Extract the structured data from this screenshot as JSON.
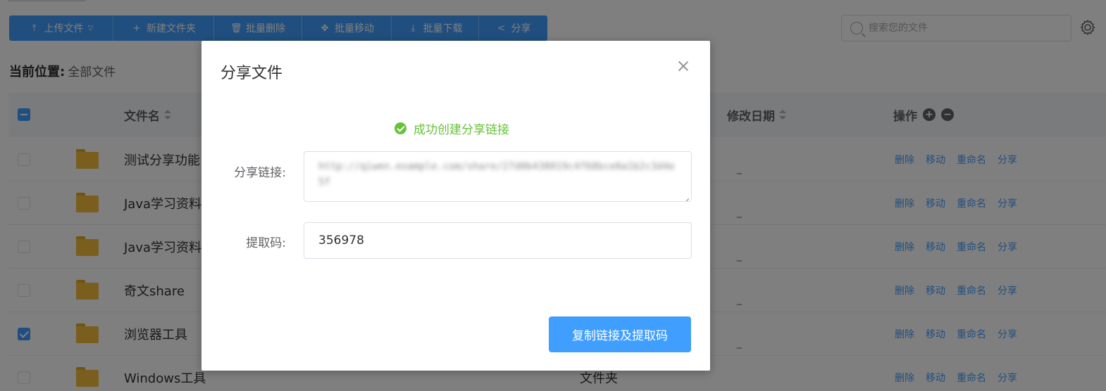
{
  "toolbar": {
    "upload_label": "上传文件",
    "new_folder_label": "新建文件夹",
    "batch_delete_label": "批量删除",
    "batch_move_label": "批量移动",
    "batch_download_label": "批量下载",
    "share_label": "分享"
  },
  "search": {
    "placeholder": "搜索您的文件"
  },
  "location": {
    "label": "当前位置:",
    "value": "全部文件"
  },
  "table": {
    "headers": {
      "name": "文件名",
      "modified": "修改日期",
      "actions": "操作"
    },
    "rows": [
      {
        "name": "测试分享功能",
        "type": "",
        "checked": false
      },
      {
        "name": "Java学习资料",
        "type": "",
        "checked": false
      },
      {
        "name": "Java学习资料",
        "type": "",
        "checked": false
      },
      {
        "name": "奇文share",
        "type": "",
        "checked": false
      },
      {
        "name": "浏览器工具",
        "type": "",
        "checked": true
      },
      {
        "name": "Windows工具",
        "type": "文件夹",
        "checked": false
      }
    ],
    "dash": "_",
    "ops": {
      "delete": "删除",
      "move": "移动",
      "rename": "重命名",
      "share": "分享"
    }
  },
  "dialog": {
    "title": "分享文件",
    "success_message": "成功创建分享链接",
    "link_label": "分享链接:",
    "link_value": "http://qiwen.example.com/share/27d0b438019c4f68bce0a1b2c3d4e5f",
    "code_label": "提取码:",
    "code_value": "356978",
    "copy_button": "复制链接及提取码"
  },
  "colors": {
    "primary": "#409eff",
    "success": "#67c23a",
    "folder": "#f5bd3a"
  }
}
